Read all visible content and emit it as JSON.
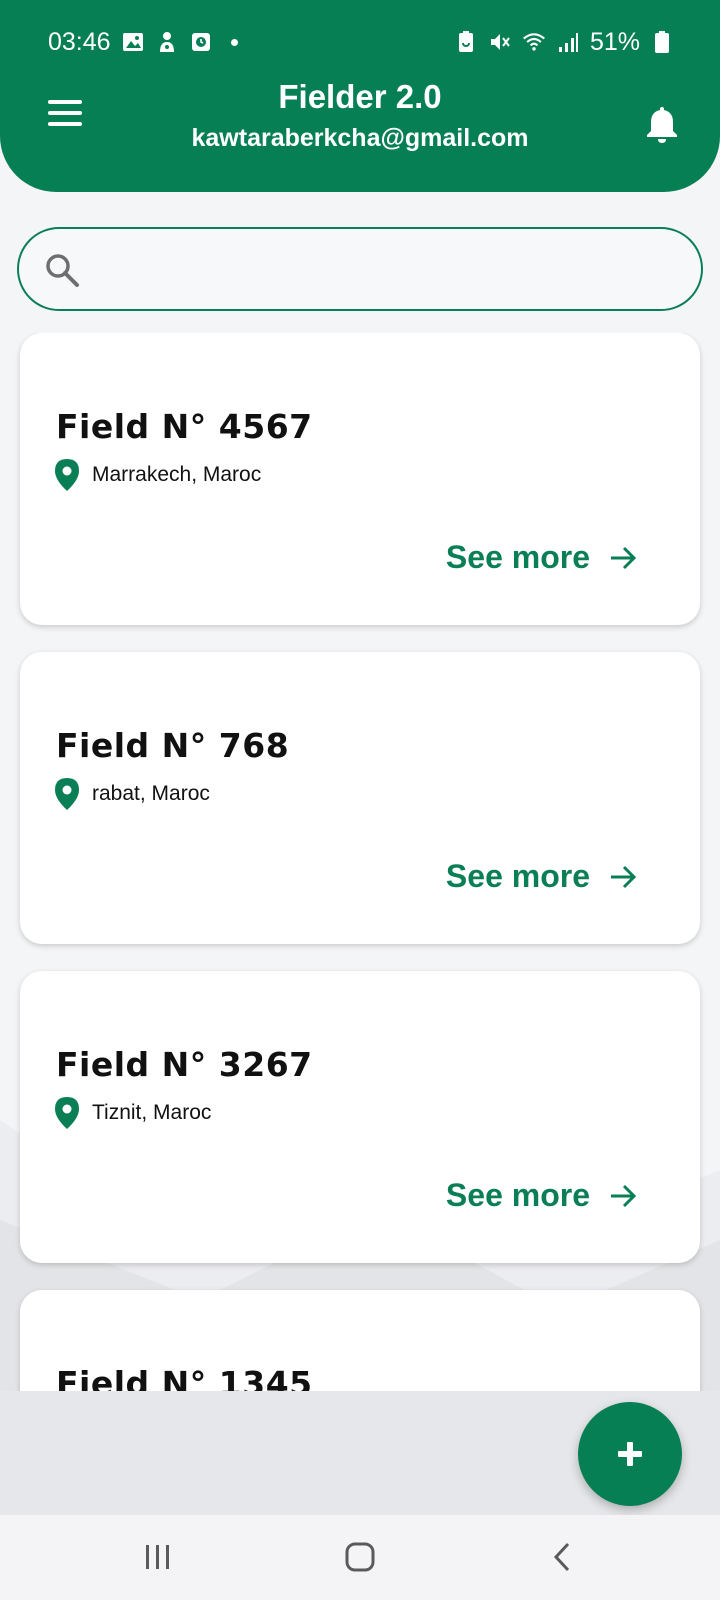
{
  "status_bar": {
    "time": "03:46",
    "battery": "51%",
    "icons_left": [
      "image-icon",
      "game-icon",
      "clock-app-icon",
      "dot-icon"
    ],
    "icons_right": [
      "battery-saver-icon",
      "mute-icon",
      "wifi-icon",
      "signal-icon",
      "battery-icon"
    ]
  },
  "app_bar": {
    "title": "Fielder 2.0",
    "email": "kawtaraberkcha@gmail.com"
  },
  "search": {
    "value": "",
    "placeholder": ""
  },
  "fields": [
    {
      "title": "Field N° 4567",
      "location": "Marrakech, Maroc",
      "action": "See more"
    },
    {
      "title": "Field N° 768",
      "location": "rabat, Maroc",
      "action": "See more"
    },
    {
      "title": "Field N° 3267",
      "location": "Tiznit, Maroc",
      "action": "See more"
    },
    {
      "title": "Field N° 1345",
      "location": "",
      "action": ""
    }
  ],
  "colors": {
    "primary": "#077f55",
    "background": "#f4f5f7",
    "card": "#ffffff"
  },
  "fab": {
    "icon": "plus-icon"
  },
  "nav_bar": {
    "icons": [
      "recent-apps-icon",
      "home-icon",
      "back-icon"
    ]
  }
}
